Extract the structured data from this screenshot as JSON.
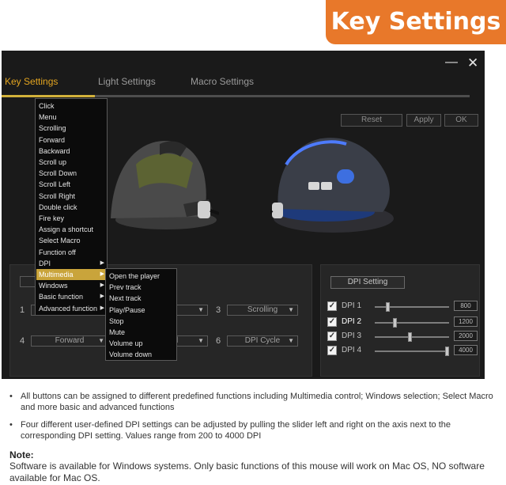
{
  "banner": {
    "title": "Key Settings"
  },
  "window": {
    "minimize_glyph": "—",
    "close_glyph": "✕"
  },
  "tabs": [
    {
      "label": "Key Settings",
      "active": true
    },
    {
      "label": "Light Settings",
      "active": false
    },
    {
      "label": "Macro Settings",
      "active": false
    }
  ],
  "toolbar": {
    "reset": "Reset",
    "apply": "Apply",
    "ok": "OK"
  },
  "button_panel": {
    "rows": [
      {
        "num": "1",
        "left_value": "",
        "right_num": "3",
        "right_value": "Scrolling",
        "middle_value": "u"
      },
      {
        "num": "4",
        "left_value": "Forward",
        "right_num": "6",
        "right_value": "DPI Cycle",
        "middle_value": "ard"
      }
    ]
  },
  "context_menu": {
    "items": [
      "Click",
      "Menu",
      "Scrolling",
      "Forward",
      "Backward",
      "Scroll up",
      "Scroll Down",
      "Scroll Left",
      "Scroll Right",
      "Double click",
      "Fire key",
      "Assign a shortcut",
      "Select Macro",
      "Function off",
      "DPI",
      "Multimedia",
      "Windows",
      "Basic function",
      "Advanced function"
    ],
    "highlighted": "Multimedia"
  },
  "submenu": {
    "items": [
      "Open the player",
      "Prev track",
      "Next  track",
      "Play/Pause",
      "Stop",
      "Mute",
      "Volume up",
      "Volume down"
    ]
  },
  "dpi_panel": {
    "button": "DPI Setting",
    "rows": [
      {
        "label": "DPI 1",
        "value": "800",
        "checked": true,
        "level": 0.16
      },
      {
        "label": "DPI 2",
        "value": "1200",
        "checked": true,
        "level": 0.26
      },
      {
        "label": "DPI 3",
        "value": "2000",
        "checked": true,
        "level": 0.47
      },
      {
        "label": "DPI 4",
        "value": "4000",
        "checked": true,
        "level": 1.0
      }
    ]
  },
  "bullets": [
    "All buttons can be assigned to different predefined functions including Multimedia control; Windows selection; Select Macro and more basic and advanced functions",
    "Four different user-defined DPI settings can be adjusted by pulling the slider left and right on the axis next to the corresponding DPI setting. Values range from 200 to 4000 DPI"
  ],
  "note": {
    "title": "Note:",
    "body": "Software is available for Windows systems. Only basic functions of this mouse will work on Mac OS, NO software available for Mac OS."
  },
  "colors": {
    "banner": "#e8782a",
    "accent": "#d2b13a",
    "menu_highlight": "#c9a43b",
    "app_bg": "#1a1a1a"
  }
}
